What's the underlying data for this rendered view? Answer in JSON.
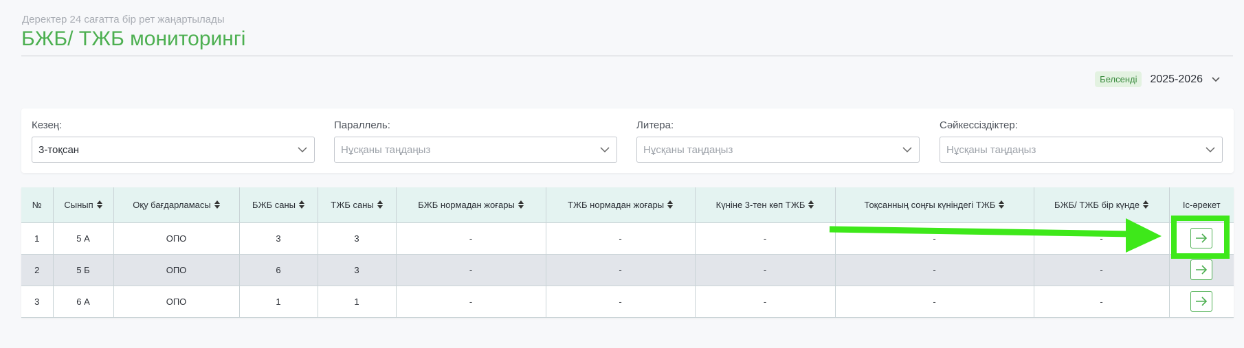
{
  "header": {
    "subtitle": "Деректер 24 сағатта бір рет жаңартылады",
    "title": "БЖБ/ ТЖБ мониторингі"
  },
  "year": {
    "badge": "Белсенді",
    "value": "2025-2026"
  },
  "filters": [
    {
      "label": "Кезең:",
      "value": "3-тоқсан",
      "placeholder": ""
    },
    {
      "label": "Параллель:",
      "value": "",
      "placeholder": "Нұсқаны таңдаңыз"
    },
    {
      "label": "Литера:",
      "value": "",
      "placeholder": "Нұсқаны таңдаңыз"
    },
    {
      "label": "Сәйкессіздіктер:",
      "value": "",
      "placeholder": "Нұсқаны таңдаңыз"
    }
  ],
  "table": {
    "headers": [
      "№",
      "Сынып",
      "Оқу бағдарламасы",
      "БЖБ саны",
      "ТЖБ саны",
      "БЖБ нормадан жоғары",
      "ТЖБ нормадан жоғары",
      "Күніне 3-тен көп ТЖБ",
      "Тоқсанның соңғы күніндегі ТЖБ",
      "БЖБ/ ТЖБ бір күнде",
      "Іс-әрекет"
    ],
    "rows": [
      [
        "1",
        "5 А",
        "ОПО",
        "3",
        "3",
        "-",
        "-",
        "-",
        "-",
        "-"
      ],
      [
        "2",
        "5 Б",
        "ОПО",
        "6",
        "3",
        "-",
        "-",
        "-",
        "-",
        "-"
      ],
      [
        "3",
        "6 А",
        "ОПО",
        "1",
        "1",
        "-",
        "-",
        "-",
        "-",
        "-"
      ]
    ]
  },
  "colors": {
    "accent": "#4caf50",
    "annotation": "#3ee81a"
  },
  "icons": {
    "chevron": "chevron-down-icon",
    "sort": "sort-icon",
    "action": "arrow-right-icon"
  }
}
